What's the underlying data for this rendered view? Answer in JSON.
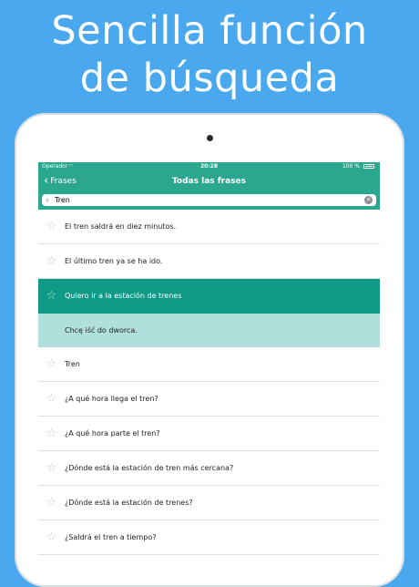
{
  "promo": {
    "line1": "Sencilla función",
    "line2": "de búsqueda"
  },
  "status_bar": {
    "carrier": "Operador",
    "time": "20:28",
    "battery": "100 %"
  },
  "nav": {
    "back_label": "Frases",
    "title": "Todas las frases"
  },
  "search": {
    "value": "Tren"
  },
  "phrases": [
    "El tren saldrá en diez minutos.",
    "El último tren ya se ha ido.",
    "Quiero ir a la estación de trenes",
    "Tren",
    "¿A qué hora llega el tren?",
    "¿A qué hora parte el tren?",
    "¿Dónde está la estación de tren más cercana?",
    "¿Dónde está la estación de trenes?",
    "¿Saldrá el tren a tiempo?"
  ],
  "selected_translation": "Chcę iść do dworca.",
  "colors": {
    "background": "#4aa8ee",
    "bar": "#2aa78e",
    "selected_row": "#0f9a87",
    "translation_row": "#b1e0dc"
  }
}
